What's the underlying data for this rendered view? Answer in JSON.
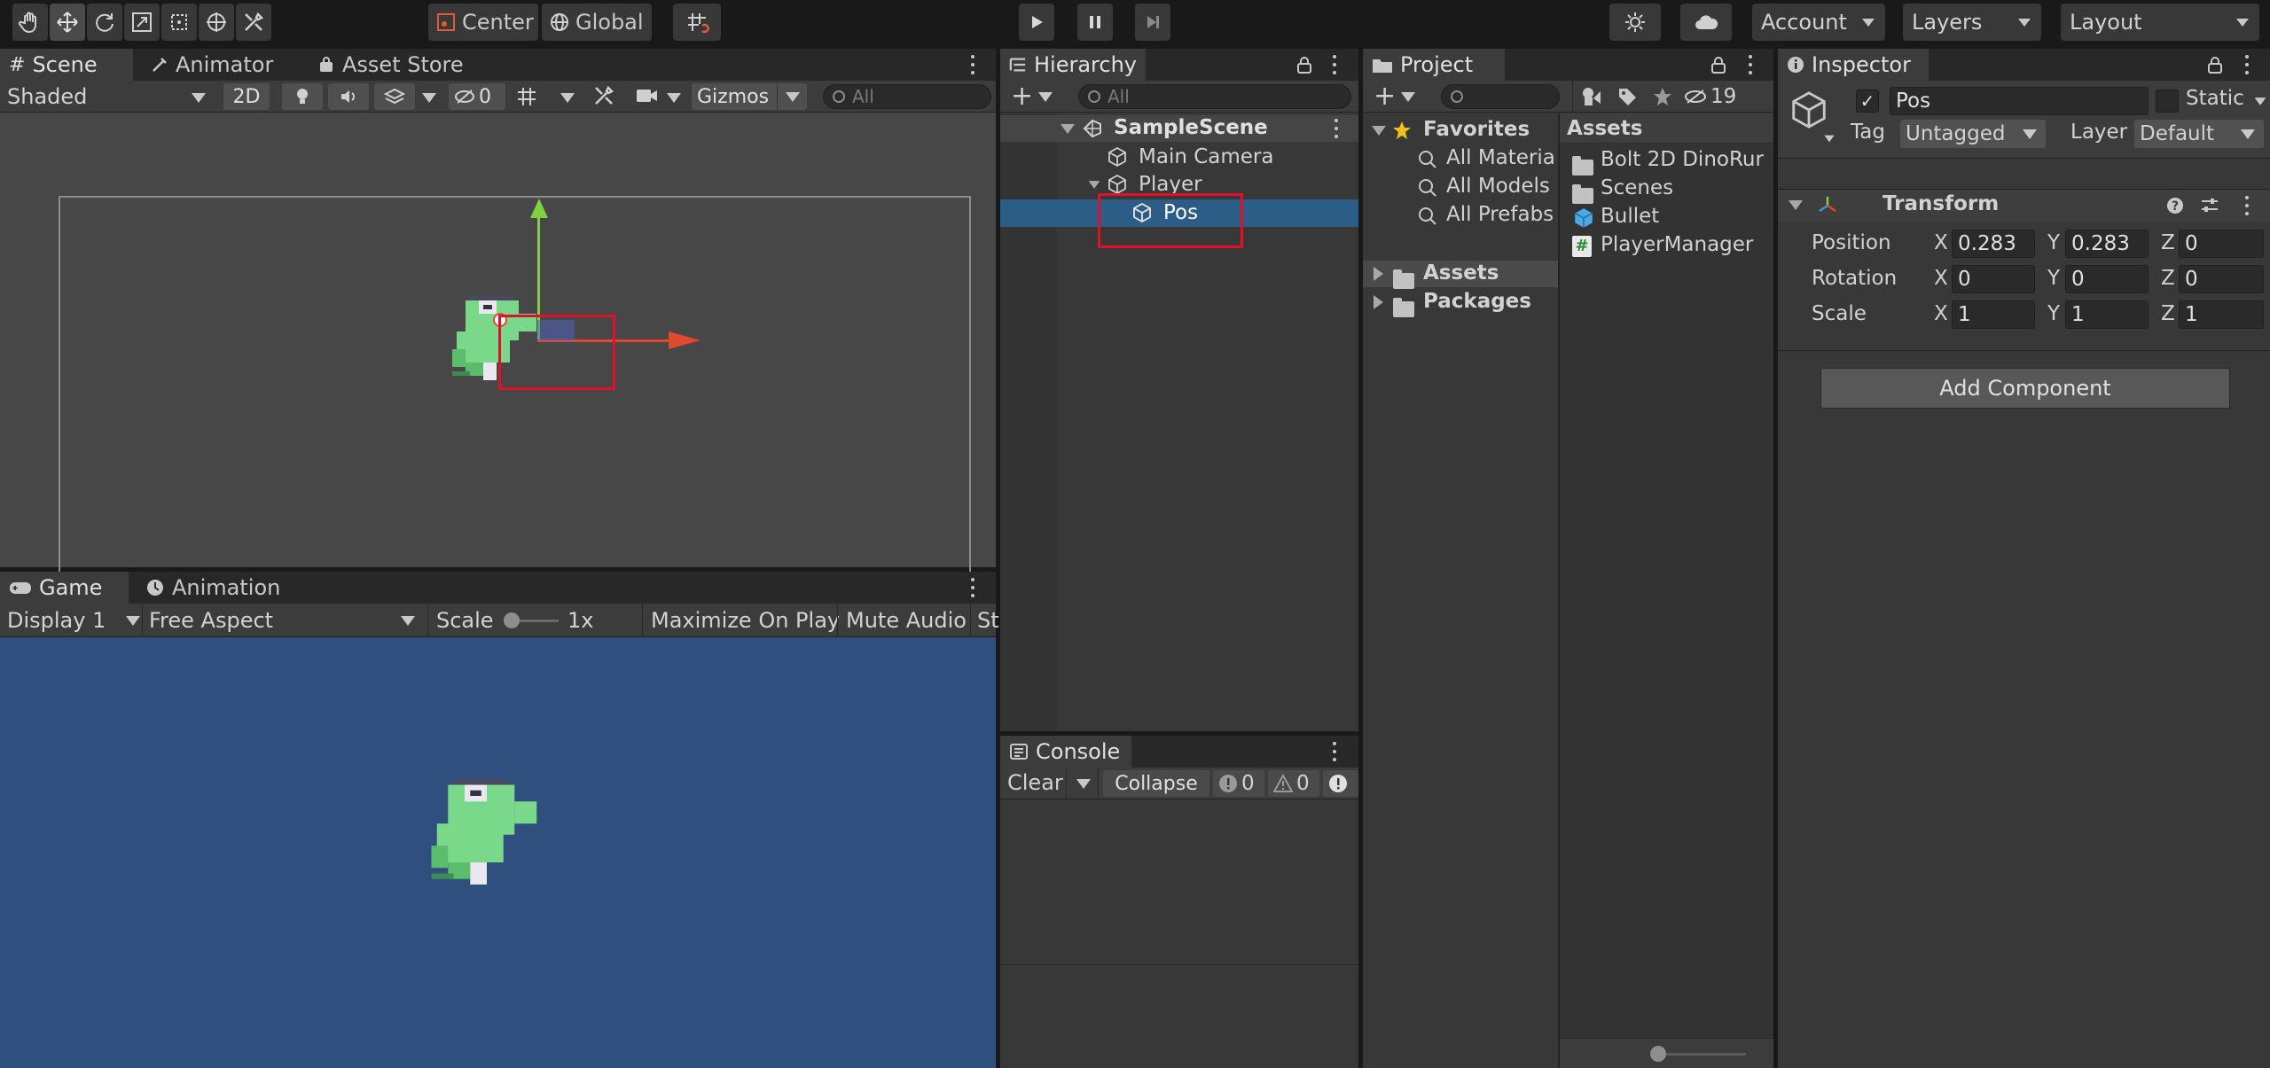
{
  "toolbar": {
    "pivot_label": "Center",
    "space_label": "Global",
    "account_label": "Account",
    "layers_label": "Layers",
    "layout_label": "Layout"
  },
  "scene": {
    "tabs": [
      "Scene",
      "Animator",
      "Asset Store"
    ],
    "shading": "Shaded",
    "mode_2d": "2D",
    "hidden_count": "0",
    "gizmos": "Gizmos",
    "search_placeholder": "All"
  },
  "game": {
    "tabs": [
      "Game",
      "Animation"
    ],
    "display": "Display 1",
    "aspect": "Free Aspect",
    "scale_label": "Scale",
    "scale_value": "1x",
    "maximize": "Maximize On Play",
    "mute": "Mute Audio",
    "stats_partial": "St",
    "background_color": "#2f4f7e"
  },
  "hierarchy": {
    "title": "Hierarchy",
    "search_placeholder": "All",
    "scene_name": "SampleScene",
    "items": [
      "Main Camera",
      "Player",
      "Pos"
    ]
  },
  "console": {
    "title": "Console",
    "clear": "Clear",
    "collapse": "Collapse",
    "info_count": "0",
    "warn_count": "0"
  },
  "project": {
    "title": "Project",
    "hidden_count": "19",
    "favorites_label": "Favorites",
    "favorites": [
      "All Materia",
      "All Models",
      "All Prefabs"
    ],
    "tree": [
      "Assets",
      "Packages"
    ],
    "assets_header": "Assets",
    "assets": [
      "Bolt 2D DinoRur",
      "Scenes",
      "Bullet",
      "PlayerManager"
    ]
  },
  "inspector": {
    "title": "Inspector",
    "object_name": "Pos",
    "static_label": "Static",
    "tag_label": "Tag",
    "tag_value": "Untagged",
    "layer_label": "Layer",
    "layer_value": "Default",
    "component_title": "Transform",
    "position_label": "Position",
    "rotation_label": "Rotation",
    "scale_label": "Scale",
    "axis_x": "X",
    "axis_y": "Y",
    "axis_z": "Z",
    "position": [
      "0.283",
      "0.283",
      "0"
    ],
    "rotation": [
      "0",
      "0",
      "0"
    ],
    "scale": [
      "1",
      "1",
      "1"
    ],
    "add_component": "Add Component"
  }
}
